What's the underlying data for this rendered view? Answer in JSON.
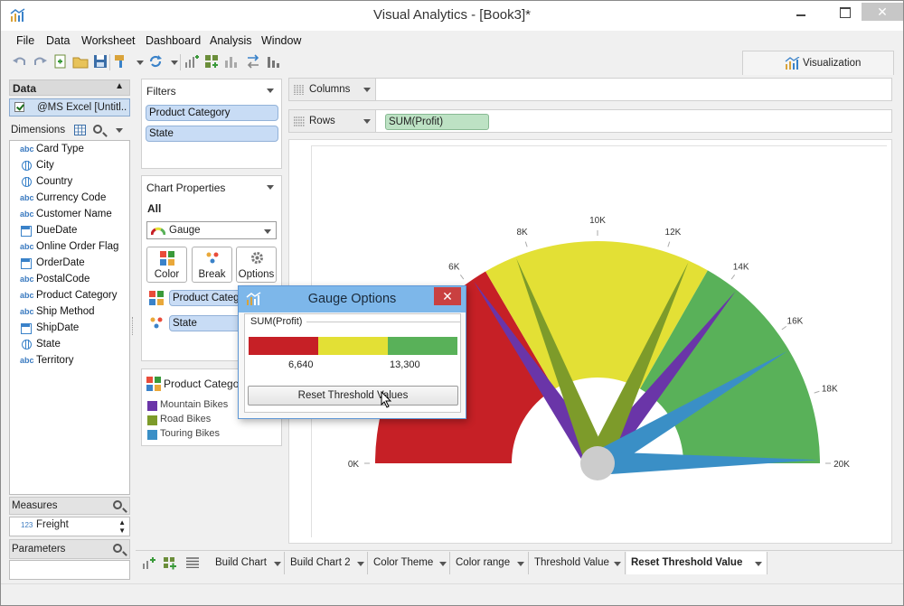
{
  "window": {
    "title": "Visual Analytics - [Book3]*"
  },
  "menu": [
    "File",
    "Data",
    "Worksheet",
    "Dashboard",
    "Analysis",
    "Window"
  ],
  "visualization_tab": {
    "label": "Visualization"
  },
  "data_panel": {
    "header": "Data",
    "datasource": "@MS Excel [Untitl...",
    "dimensions_label": "Dimensions",
    "dimensions": [
      {
        "label": "Card Type",
        "type": "abc"
      },
      {
        "label": "City",
        "type": "geo"
      },
      {
        "label": "Country",
        "type": "geo"
      },
      {
        "label": "Currency Code",
        "type": "abc"
      },
      {
        "label": "Customer Name",
        "type": "abc"
      },
      {
        "label": "DueDate",
        "type": "date"
      },
      {
        "label": "Online Order Flag",
        "type": "abc"
      },
      {
        "label": "OrderDate",
        "type": "date"
      },
      {
        "label": "PostalCode",
        "type": "abc"
      },
      {
        "label": "Product Category",
        "type": "abc"
      },
      {
        "label": "Ship Method",
        "type": "abc"
      },
      {
        "label": "ShipDate",
        "type": "date"
      },
      {
        "label": "State",
        "type": "geo"
      },
      {
        "label": "Territory",
        "type": "abc"
      }
    ],
    "abc_tag": "abc",
    "measures_label": "Measures",
    "measures": [
      {
        "label": "Freight",
        "tag": "123"
      }
    ],
    "parameters_label": "Parameters"
  },
  "filters": {
    "title": "Filters",
    "items": [
      "Product Category",
      "State"
    ]
  },
  "chart_properties": {
    "title": "Chart Properties",
    "scope": "All",
    "chart_type": "Gauge",
    "buttons": [
      "Color",
      "Break",
      "Options"
    ],
    "marks": [
      "Product Category",
      "State"
    ]
  },
  "legend": {
    "title": "Product Category",
    "items": [
      {
        "label": "Mountain Bikes",
        "color": "#6a35a8"
      },
      {
        "label": "Road Bikes",
        "color": "#7d9b2a"
      },
      {
        "label": "Touring Bikes",
        "color": "#3a8fc6"
      }
    ]
  },
  "shelves": {
    "columns_label": "Columns",
    "rows_label": "Rows",
    "rows_pill": "SUM(Profit)"
  },
  "chart_data": {
    "type": "gauge",
    "min": 0,
    "max": 20000,
    "ticks": [
      "0K",
      "6K",
      "8K",
      "10K",
      "12K",
      "14K",
      "16K",
      "18K",
      "20K"
    ],
    "tick_values": [
      0,
      6000,
      8000,
      10000,
      12000,
      14000,
      16000,
      18000,
      20000
    ],
    "bands": [
      {
        "from": 0,
        "to": 6640,
        "color": "#c62026"
      },
      {
        "from": 6640,
        "to": 13300,
        "color": "#e3e035"
      },
      {
        "from": 13300,
        "to": 20000,
        "color": "#59b159"
      }
    ],
    "needles": [
      {
        "series": "Mountain Bikes",
        "color": "#6a35a8",
        "value": 6200
      },
      {
        "series": "Road Bikes",
        "color": "#7d9b2a",
        "value": 7600
      },
      {
        "series": "Mountain Bikes",
        "color": "#6a35a8",
        "value": 14300
      },
      {
        "series": "Road Bikes",
        "color": "#7d9b2a",
        "value": 12700
      },
      {
        "series": "Touring Bikes",
        "color": "#3a8fc6",
        "value": 16600
      },
      {
        "series": "Touring Bikes",
        "color": "#3a8fc6",
        "value": 19900
      }
    ]
  },
  "gauge_options": {
    "title": "Gauge Options",
    "field": "SUM(Profit)",
    "thresholds": [
      "6,640",
      "13,300"
    ],
    "colors": [
      "#c62026",
      "#e3e035",
      "#59b159"
    ],
    "reset_button": "Reset Threshold Values"
  },
  "sheet_tabs": [
    {
      "label": "Build Chart",
      "active": false
    },
    {
      "label": "Build Chart 2",
      "active": false
    },
    {
      "label": "Color Theme",
      "active": false
    },
    {
      "label": "Color range",
      "active": false
    },
    {
      "label": "Threshold Value",
      "active": false
    },
    {
      "label": "Reset Threshold Value",
      "active": true
    }
  ]
}
